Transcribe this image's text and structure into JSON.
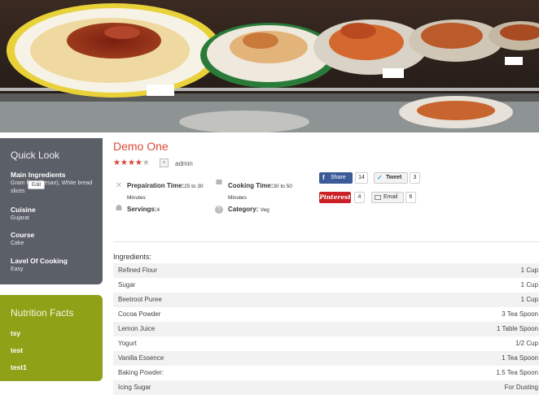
{
  "hero": {
    "alt_icon": "pasta-display-photo"
  },
  "sidebar": {
    "quick_look": {
      "title": "Quick Look",
      "items": [
        {
          "label": "Main Ingredients",
          "value": "Gram flour (besan), White bread slices"
        },
        {
          "label": "Cuisine",
          "value": "Gujarat"
        },
        {
          "label": "Course",
          "value": "Cake"
        },
        {
          "label": "Lavel Of Cooking",
          "value": "Easy"
        }
      ],
      "edit_tooltip": "Edit"
    },
    "nutrition": {
      "title": "Nutrition Facts",
      "items": [
        "tsy",
        "test",
        "test1"
      ]
    }
  },
  "recipe": {
    "title": "Demo One",
    "rating": 4,
    "rating_max": 5,
    "author": "admin",
    "prep_label": "Prepairation Time:",
    "prep_value": "25 to 30",
    "prep_unit": "Minutes",
    "cook_label": "Cooking Time:",
    "cook_value": "30 to 50",
    "cook_unit": "Minutes",
    "servings_label": "Servings:",
    "servings_value": "4",
    "category_label": "Category:",
    "category_value": "Veg"
  },
  "share": {
    "facebook_label": "Share",
    "facebook_count": "14",
    "twitter_label": "Tweet",
    "twitter_count": "3",
    "pinterest_label": "Pinterest",
    "pinterest_count": "4",
    "email_label": "Email",
    "email_count": "6",
    "colors": {
      "facebook": "#3b5b98",
      "pinterest": "#cb2027",
      "twitter": "#2ba9e1"
    }
  },
  "ingredients": {
    "heading": "Ingredients:",
    "rows": [
      {
        "name": "Refined Flour",
        "qty": "1 Cup"
      },
      {
        "name": "Sugar",
        "qty": "1 Cup"
      },
      {
        "name": "Beetroot Puree",
        "qty": "1 Cup"
      },
      {
        "name": "Cocoa Powder",
        "qty": "3 Tea Spoon"
      },
      {
        "name": "Lemon Juice",
        "qty": "1 Table Spoon"
      },
      {
        "name": "Yogurt",
        "qty": "1/2 Cup"
      },
      {
        "name": "Vanilla Essence",
        "qty": "1 Tea Spoon"
      },
      {
        "name": "Baking Powder:",
        "qty": "1.5 Tea Spoon"
      },
      {
        "name": "Icing Sugar",
        "qty": "For Dusting"
      }
    ]
  },
  "colors": {
    "title_accent": "#d84a35",
    "quick_look_bg": "#5b5f68",
    "nutrition_bg": "#8fa117",
    "star_on": "#d9453a"
  }
}
